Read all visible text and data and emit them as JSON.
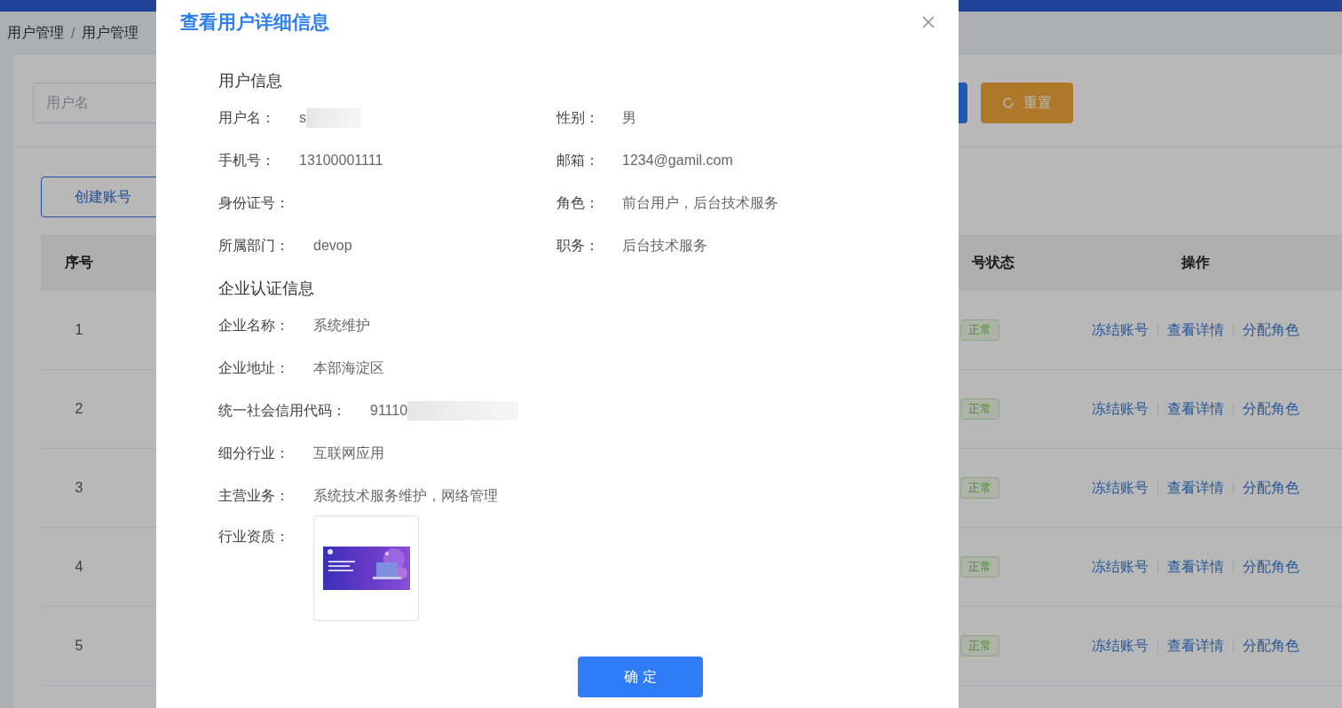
{
  "background": {
    "breadcrumb": [
      "用户管理",
      "用户管理"
    ],
    "breadcrumb_separator": "/",
    "search": {
      "placeholder": "用户名"
    },
    "reset_button": "重置",
    "create_button": "创建账号",
    "table": {
      "columns": [
        "序号",
        "号状态",
        "操作"
      ],
      "rows": [
        {
          "index": "1",
          "status": "正常",
          "actions": [
            "冻结账号",
            "查看详情",
            "分配角色"
          ]
        },
        {
          "index": "2",
          "status": "正常",
          "actions": [
            "冻结账号",
            "查看详情",
            "分配角色"
          ]
        },
        {
          "index": "3",
          "status": "正常",
          "actions": [
            "冻结账号",
            "查看详情",
            "分配角色"
          ]
        },
        {
          "index": "4",
          "status": "正常",
          "actions": [
            "冻结账号",
            "查看详情",
            "分配角色"
          ]
        },
        {
          "index": "5",
          "status": "正常",
          "actions": [
            "冻结账号",
            "查看详情",
            "分配角色"
          ]
        }
      ]
    }
  },
  "dialog": {
    "title": "查看用户详细信息",
    "user_section": {
      "heading": "用户信息",
      "rows": [
        {
          "left": {
            "label": "用户名：",
            "value": "s",
            "redacted": true
          },
          "right": {
            "label": "性别：",
            "value": "男",
            "redacted": false
          }
        },
        {
          "left": {
            "label": "手机号：",
            "value": "13100001111",
            "redacted": false
          },
          "right": {
            "label": "邮箱：",
            "value": "1234@gamil.com",
            "redacted": false
          }
        },
        {
          "left": {
            "label": "身份证号：",
            "redacted": false
          },
          "right": {
            "label": "角色：",
            "value": "前台用户，后台技术服务",
            "redacted": false
          }
        },
        {
          "left": {
            "label": "所属部门：",
            "value": "devop",
            "redacted": false
          },
          "right": {
            "label": "职务：",
            "value": "后台技术服务",
            "redacted": false
          }
        }
      ]
    },
    "company_section": {
      "heading": "企业认证信息",
      "fields": [
        {
          "kind": "text",
          "label": "企业名称：",
          "value": "系统维护",
          "redacted": false
        },
        {
          "kind": "text",
          "label": "企业地址：",
          "value": "本部海淀区",
          "redacted": false
        },
        {
          "kind": "text",
          "label": "统一社会信用代码：",
          "value": "91110",
          "redacted": true
        },
        {
          "kind": "text",
          "label": "细分行业：",
          "value": "互联网应用",
          "redacted": false
        },
        {
          "kind": "text",
          "label": "主营业务：",
          "value": "系统技术服务维护，网络管理",
          "redacted": false
        },
        {
          "label": "行业资质："
        }
      ]
    },
    "confirm_button": "确 定"
  }
}
